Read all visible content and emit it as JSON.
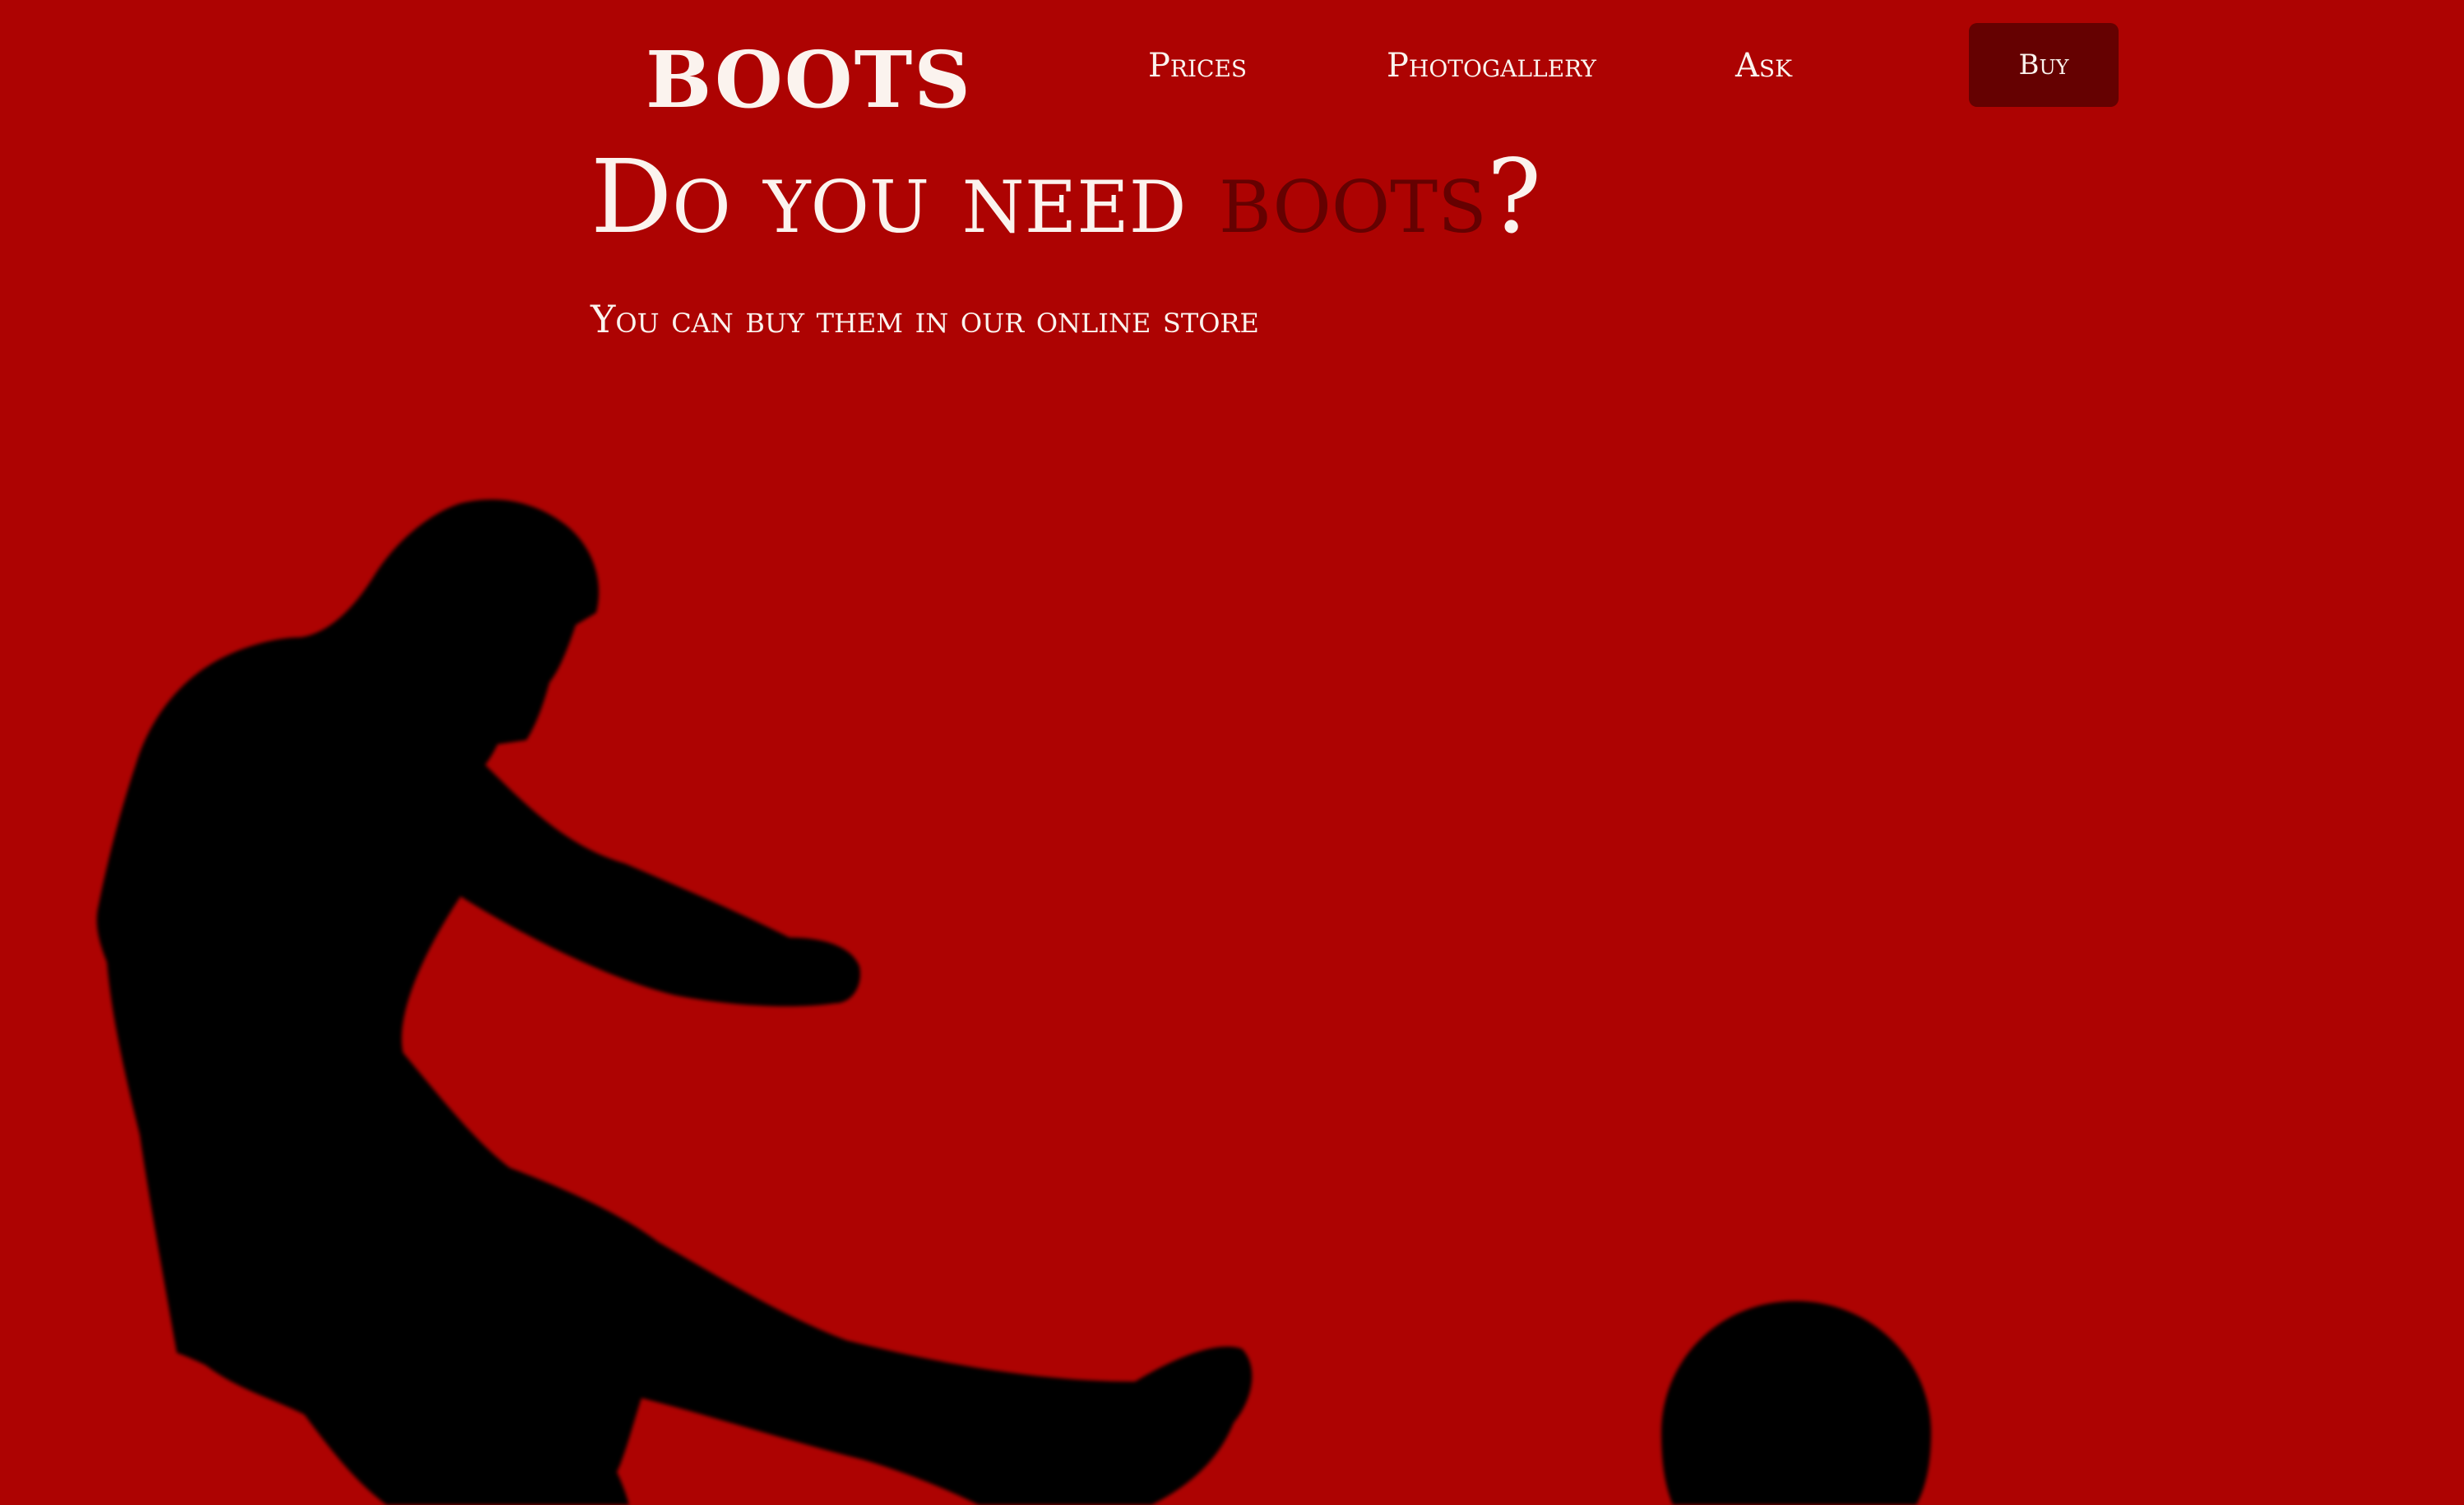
{
  "header": {
    "logo": "boots",
    "nav": {
      "prices": "Prices",
      "gallery": "Photogallery",
      "ask": "Ask"
    },
    "buy_label": "Buy"
  },
  "hero": {
    "title_prefix": "Do you need ",
    "title_accent": "boots",
    "title_suffix": "?",
    "subtitle": "You can buy them in our online store"
  },
  "images": {
    "player": "football-player-silhouette",
    "ball": "football-silhouette"
  },
  "colors": {
    "background": "#ad0302",
    "accent": "#650101",
    "text": "#fbf3ee",
    "silhouette": "#050000"
  }
}
